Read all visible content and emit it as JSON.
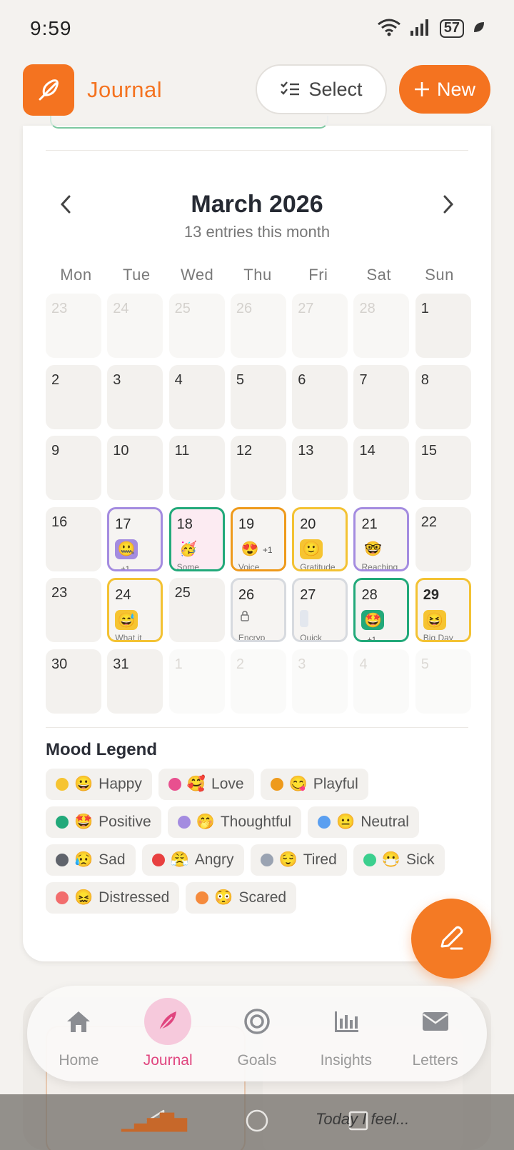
{
  "status_bar": {
    "time": "9:59",
    "battery": "57"
  },
  "header": {
    "title": "Journal",
    "select_label": "Select",
    "new_label": "New"
  },
  "calendar": {
    "month_title": "March 2026",
    "entries_count": "13 entries this month",
    "weekdays": [
      "Mon",
      "Tue",
      "Wed",
      "Thu",
      "Fri",
      "Sat",
      "Sun"
    ],
    "days": [
      {
        "n": "23",
        "kind": "out"
      },
      {
        "n": "24",
        "kind": "out"
      },
      {
        "n": "25",
        "kind": "out"
      },
      {
        "n": "26",
        "kind": "out"
      },
      {
        "n": "27",
        "kind": "out"
      },
      {
        "n": "28",
        "kind": "out"
      },
      {
        "n": "1"
      },
      {
        "n": "2"
      },
      {
        "n": "3"
      },
      {
        "n": "4"
      },
      {
        "n": "5"
      },
      {
        "n": "6"
      },
      {
        "n": "7"
      },
      {
        "n": "8"
      },
      {
        "n": "9"
      },
      {
        "n": "10"
      },
      {
        "n": "11"
      },
      {
        "n": "12"
      },
      {
        "n": "13"
      },
      {
        "n": "14"
      },
      {
        "n": "15"
      },
      {
        "n": "16"
      },
      {
        "n": "17",
        "border": "#a48ce0",
        "emoji": "🤐",
        "emoji_bg": "#a48ce0",
        "more": "+1"
      },
      {
        "n": "18",
        "border": "#22a97a",
        "emoji": "🥳",
        "pink": true,
        "snippet": "Some"
      },
      {
        "n": "19",
        "border": "#ee9a1c",
        "emoji": "😍",
        "more_inline": "+1",
        "snippet": "Voice"
      },
      {
        "n": "20",
        "border": "#f3c233",
        "emoji": "🙂",
        "emoji_bg": "#f6c431",
        "snippet": "Gratitude"
      },
      {
        "n": "21",
        "border": "#a48ce0",
        "emoji": "🤓",
        "snippet": "Reaching"
      },
      {
        "n": "22"
      },
      {
        "n": "23"
      },
      {
        "n": "24",
        "border": "#f3c233",
        "emoji": "😅",
        "emoji_bg": "#f6c431",
        "snippet": "What it"
      },
      {
        "n": "25"
      },
      {
        "n": "26",
        "border": "#d7dadf",
        "lock": true,
        "snippet": "Encryp"
      },
      {
        "n": "27",
        "border": "#d7dadf",
        "draft": true,
        "snippet": "Quick"
      },
      {
        "n": "28",
        "border": "#22a97a",
        "emoji": "🤩",
        "emoji_bg": "#22a97a",
        "more": "+1"
      },
      {
        "n": "29",
        "border": "#f3c233",
        "emoji": "😆",
        "emoji_bg": "#f6c431",
        "snippet": "Big Day",
        "today": true
      },
      {
        "n": "30"
      },
      {
        "n": "31"
      },
      {
        "n": "1",
        "kind": "next"
      },
      {
        "n": "2",
        "kind": "next"
      },
      {
        "n": "3",
        "kind": "next"
      },
      {
        "n": "4",
        "kind": "next"
      },
      {
        "n": "5",
        "kind": "next"
      }
    ]
  },
  "legend": {
    "title": "Mood Legend",
    "items": [
      {
        "label": "Happy",
        "emoji": "😀",
        "color": "#f6c431"
      },
      {
        "label": "Love",
        "emoji": "🥰",
        "color": "#e8508f"
      },
      {
        "label": "Playful",
        "emoji": "😋",
        "color": "#ee9a1c"
      },
      {
        "label": "Positive",
        "emoji": "🤩",
        "color": "#22a97a"
      },
      {
        "label": "Thoughtful",
        "emoji": "🤭",
        "color": "#a48ce0"
      },
      {
        "label": "Neutral",
        "emoji": "😐",
        "color": "#5b9ff0"
      },
      {
        "label": "Sad",
        "emoji": "😥",
        "color": "#5f636b"
      },
      {
        "label": "Angry",
        "emoji": "😤",
        "color": "#e84040"
      },
      {
        "label": "Tired",
        "emoji": "😌",
        "color": "#9aa3b2"
      },
      {
        "label": "Sick",
        "emoji": "😷",
        "color": "#3bcf8e"
      },
      {
        "label": "Distressed",
        "emoji": "😖",
        "color": "#f26d6d"
      },
      {
        "label": "Scared",
        "emoji": "😳",
        "color": "#f58a3c"
      }
    ]
  },
  "bottom_nav": [
    {
      "label": "Home",
      "icon": "home-icon"
    },
    {
      "label": "Journal",
      "icon": "feather-icon",
      "active": true
    },
    {
      "label": "Goals",
      "icon": "target-icon"
    },
    {
      "label": "Insights",
      "icon": "bar-chart-icon"
    },
    {
      "label": "Letters",
      "icon": "mail-icon"
    }
  ],
  "background_content": {
    "right_text": "Today I feel..."
  },
  "colors": {
    "accent": "#f47320",
    "journal_active": "#e0457f"
  }
}
